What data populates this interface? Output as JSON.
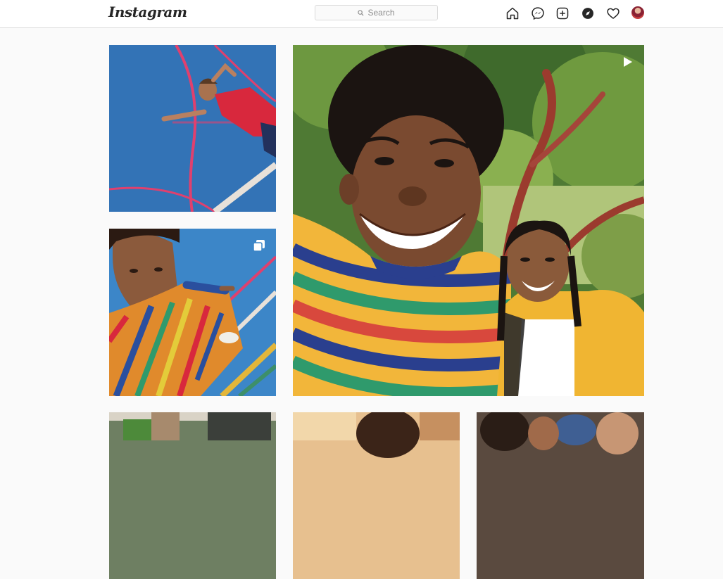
{
  "header": {
    "logo_text": "Instagram",
    "search": {
      "placeholder": "Search"
    },
    "icons": [
      "home-icon",
      "messenger-icon",
      "new-post-icon",
      "explore-icon",
      "activity-icon",
      "profile-avatar"
    ]
  },
  "grid": {
    "tiles": [
      {
        "id": "post-1",
        "kind": "photo",
        "subject": "person-lying-on-blue-court"
      },
      {
        "id": "post-2",
        "kind": "carousel",
        "badge": "carousel-icon",
        "subject": "person-in-striped-shirt-on-blue-court"
      },
      {
        "id": "post-3",
        "kind": "video",
        "badge": "video-icon",
        "subject": "selfie-two-people-under-tree"
      },
      {
        "id": "post-4",
        "kind": "photo"
      },
      {
        "id": "post-5",
        "kind": "photo"
      },
      {
        "id": "post-6",
        "kind": "photo"
      }
    ]
  },
  "colors": {
    "background": "#fafafa",
    "header_bg": "#ffffff",
    "border": "#dbdbdb",
    "text": "#262626",
    "muted": "#8e8e8e"
  }
}
